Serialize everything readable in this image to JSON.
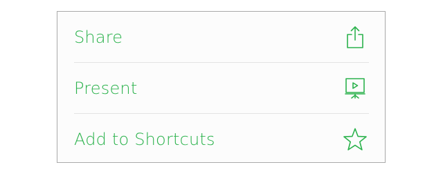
{
  "accent_color": "#2bb24c",
  "menu": {
    "items": [
      {
        "label": "Share",
        "icon": "share-icon"
      },
      {
        "label": "Present",
        "icon": "present-icon"
      },
      {
        "label": "Add to Shortcuts",
        "icon": "star-icon"
      }
    ]
  }
}
